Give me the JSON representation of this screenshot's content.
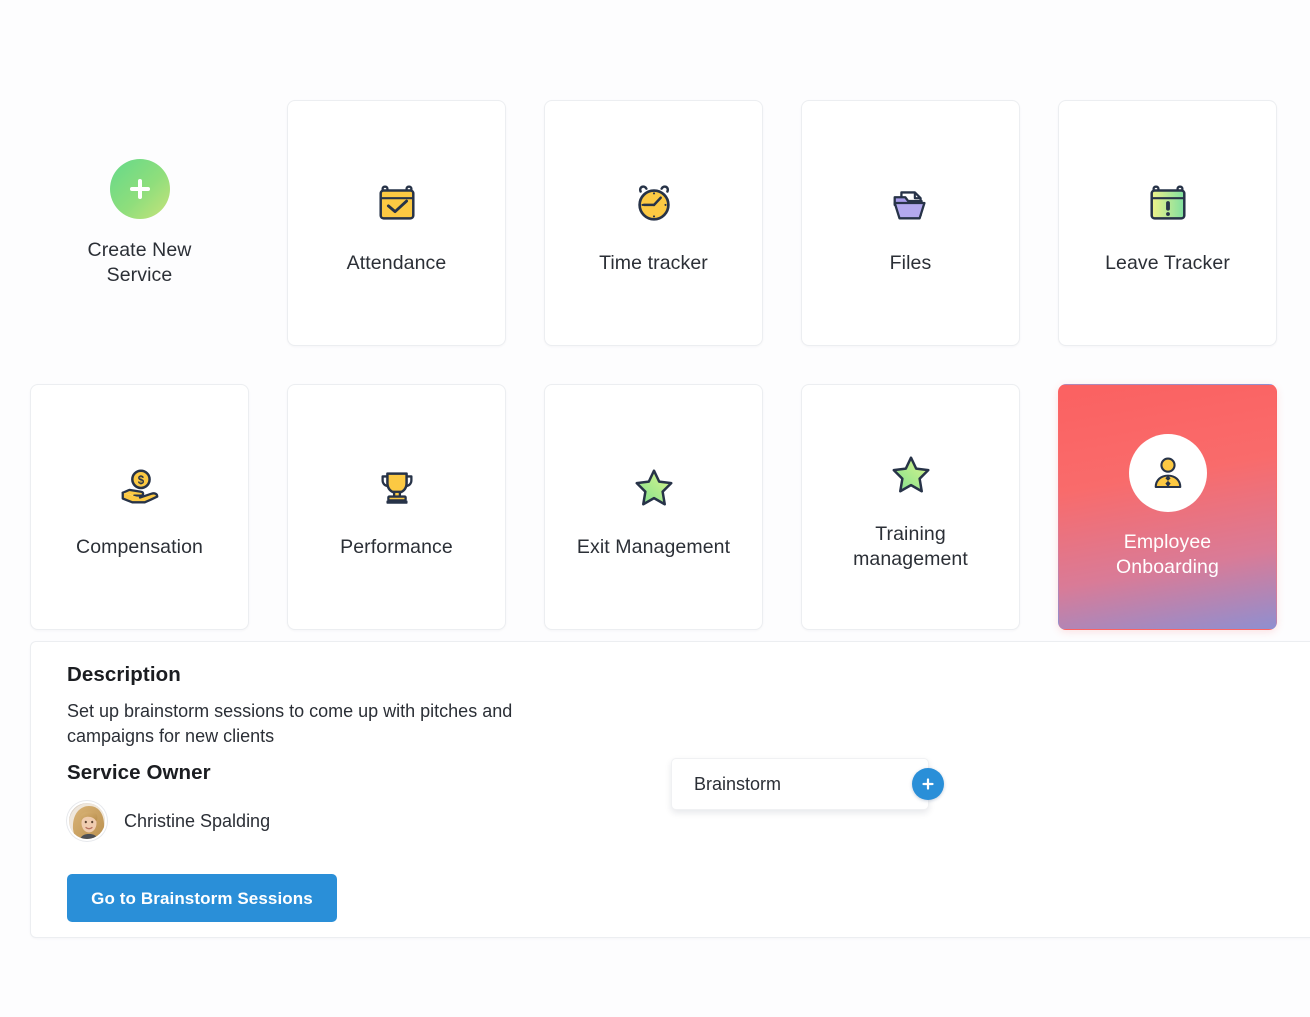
{
  "colors": {
    "page_background": "#fdfdfe",
    "card_background": "#ffffff",
    "card_border": "#eceef1",
    "text_primary": "#2b2f36",
    "heading": "#1b1d21",
    "accent_blue": "#2a8fd8",
    "icon_outline": "#273348",
    "icon_yellow": "#fcc943",
    "icon_green": "#8fe08a",
    "icon_purple": "#a79cea",
    "selected_gradient_start": "#fb6161",
    "selected_gradient_end": "#8f8fd0",
    "plus_gradient_start": "#64d98a",
    "plus_gradient_end": "#c8e37a"
  },
  "services": {
    "create": {
      "label": "Create New Service",
      "icon": "plus-icon"
    },
    "tiles": [
      {
        "label": "Attendance",
        "icon": "calendar-check-icon",
        "selected": false
      },
      {
        "label": "Time tracker",
        "icon": "alarm-clock-icon",
        "selected": false
      },
      {
        "label": "Files",
        "icon": "folder-document-icon",
        "selected": false
      },
      {
        "label": "Leave Tracker",
        "icon": "calendar-alert-icon",
        "selected": false
      },
      {
        "label": "Compensation",
        "icon": "hand-coin-icon",
        "selected": false
      },
      {
        "label": "Performance",
        "icon": "trophy-icon",
        "selected": false
      },
      {
        "label": "Exit Management",
        "icon": "star-icon",
        "selected": false
      },
      {
        "label": "Training management",
        "icon": "star-icon",
        "selected": false
      },
      {
        "label": "Employee Onboarding",
        "icon": "person-tie-icon",
        "selected": true
      }
    ]
  },
  "detail": {
    "description_heading": "Description",
    "description_text": "Set up brainstorm sessions to come up with pitches and campaigns for new clients",
    "owner_heading": "Service Owner",
    "owner_name": "Christine Spalding",
    "owner_avatar_icon": "user-photo-avatar",
    "cta_label": "Go to Brainstorm Sessions",
    "tag": {
      "value": "Brainstorm",
      "placeholder": "Brainstorm",
      "add_icon": "plus-icon"
    }
  }
}
